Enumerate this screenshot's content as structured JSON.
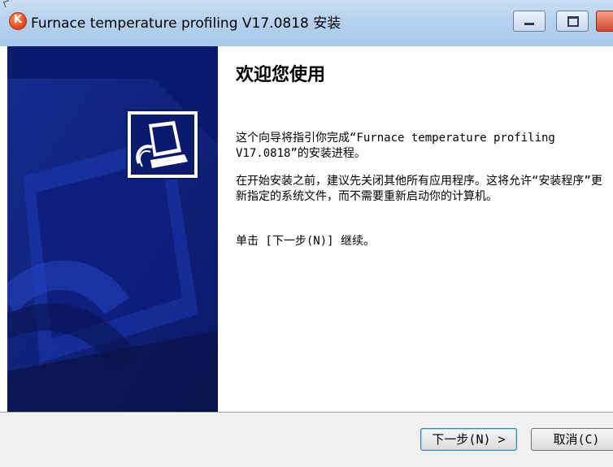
{
  "window": {
    "title": "Furnace temperature profiling V17.0818 安装",
    "app_icon_letter": "K"
  },
  "welcome": {
    "heading": "欢迎您使用",
    "paragraph1": "这个向导将指引你完成“Furnace temperature profiling V17.0818”的安装进程。",
    "paragraph2": "在开始安装之前，建议先关闭其他所有应用程序。这将允许“安装程序”更新指定的系统文件，而不需要重新启动你的计算机。",
    "paragraph3": "单击 [下一步(N)] 继续。"
  },
  "buttons": {
    "next": "下一步(N) >",
    "cancel": "取消(C)"
  },
  "colors": {
    "banner": "#0c1a6e",
    "titlebar": "#b6d2ee",
    "button_focus": "#3c7fb1"
  },
  "icons": {
    "app": "installer-app-icon",
    "banner": "installer-computer-icon"
  }
}
